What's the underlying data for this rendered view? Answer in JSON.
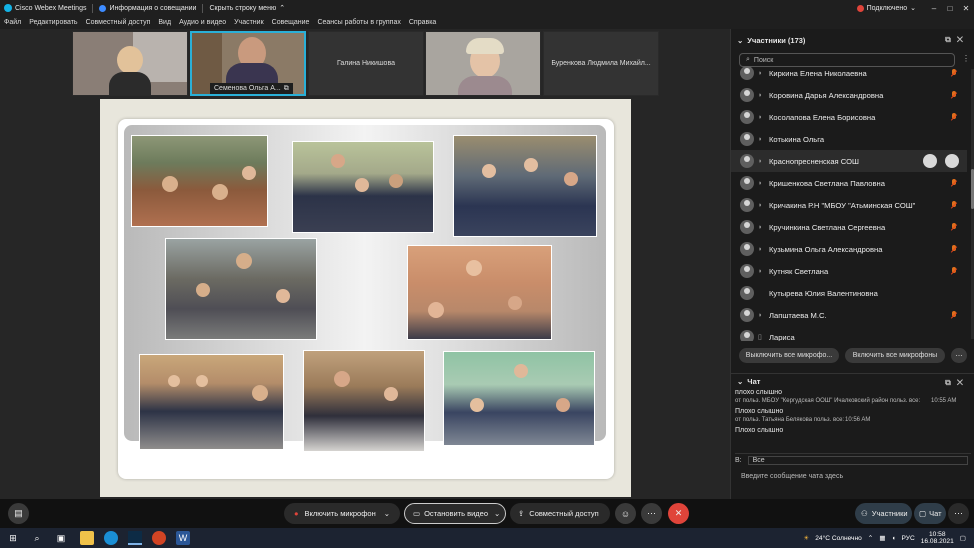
{
  "titlebar": {
    "app_title": "Cisco Webex Meetings",
    "meeting_info": "Информация о совещании",
    "hide_menu": "Скрыть строку меню",
    "status": "Подключено"
  },
  "menu": [
    "Файл",
    "Редактировать",
    "Совместный доступ",
    "Вид",
    "Аудио и видео",
    "Участник",
    "Совещание",
    "Сеансы работы в группах",
    "Справка"
  ],
  "thumbnails": [
    {
      "label": ""
    },
    {
      "label": "Семенова Ольга А..."
    },
    {
      "label": "Галина Никишова"
    },
    {
      "label": ""
    },
    {
      "label": "Буренкова Людмила Михайл..."
    }
  ],
  "participants_panel": {
    "title": "Участники (173)",
    "search_placeholder": "Поиск",
    "participants": [
      {
        "name": "Киркина Елена Николаевна"
      },
      {
        "name": "Коровина Дарья Александровна"
      },
      {
        "name": "Косолапова Елена Борисовна"
      },
      {
        "name": "Котькина Ольга"
      },
      {
        "name": "Краснопресненская СОШ"
      },
      {
        "name": "Кришенкова Светлана Павловна"
      },
      {
        "name": "Кричакина Р.Н \"МБОУ \"Атьминская СОШ\""
      },
      {
        "name": "Кручинкина Светлана Сергеевна"
      },
      {
        "name": "Кузьмина Ольга Александровна"
      },
      {
        "name": "Кутняк Светлана"
      },
      {
        "name": "Кутырева Юлия Валентиновна"
      },
      {
        "name": "Лапштаева М.С."
      },
      {
        "name": "Лариса"
      }
    ],
    "mute_all": "Выключить все микрофо...",
    "unmute_all": "Включить все микрофоны"
  },
  "chat": {
    "title": "Чат",
    "messages": [
      {
        "text": "плохо слышно",
        "meta": "от польз. МБОУ \"Кергудская ООШ\" Ичалковский район польз. все:",
        "time": "10:55 AM"
      },
      {
        "text": "Плохо слышно",
        "meta": "от польз. Татьяна Белякова польз. все:",
        "time": "10:56 AM"
      },
      {
        "text": "Плохо слышно",
        "meta": "",
        "time": ""
      }
    ],
    "to_label": "В:",
    "to_value": "Все",
    "input_placeholder": "Введите сообщение чата здесь"
  },
  "controls": {
    "mic": "Включить микрофон",
    "video": "Остановить видео",
    "share": "Совместный доступ",
    "participants": "Участники",
    "chat": "Чат"
  },
  "taskbar": {
    "weather": "24°C Солнечно",
    "lang": "РУС",
    "time": "10:58",
    "date": "16.08.2021"
  },
  "colors": {
    "accent": "#2ab0d8",
    "end_call": "#e0443a",
    "muted_mic": "#e06f1c"
  }
}
